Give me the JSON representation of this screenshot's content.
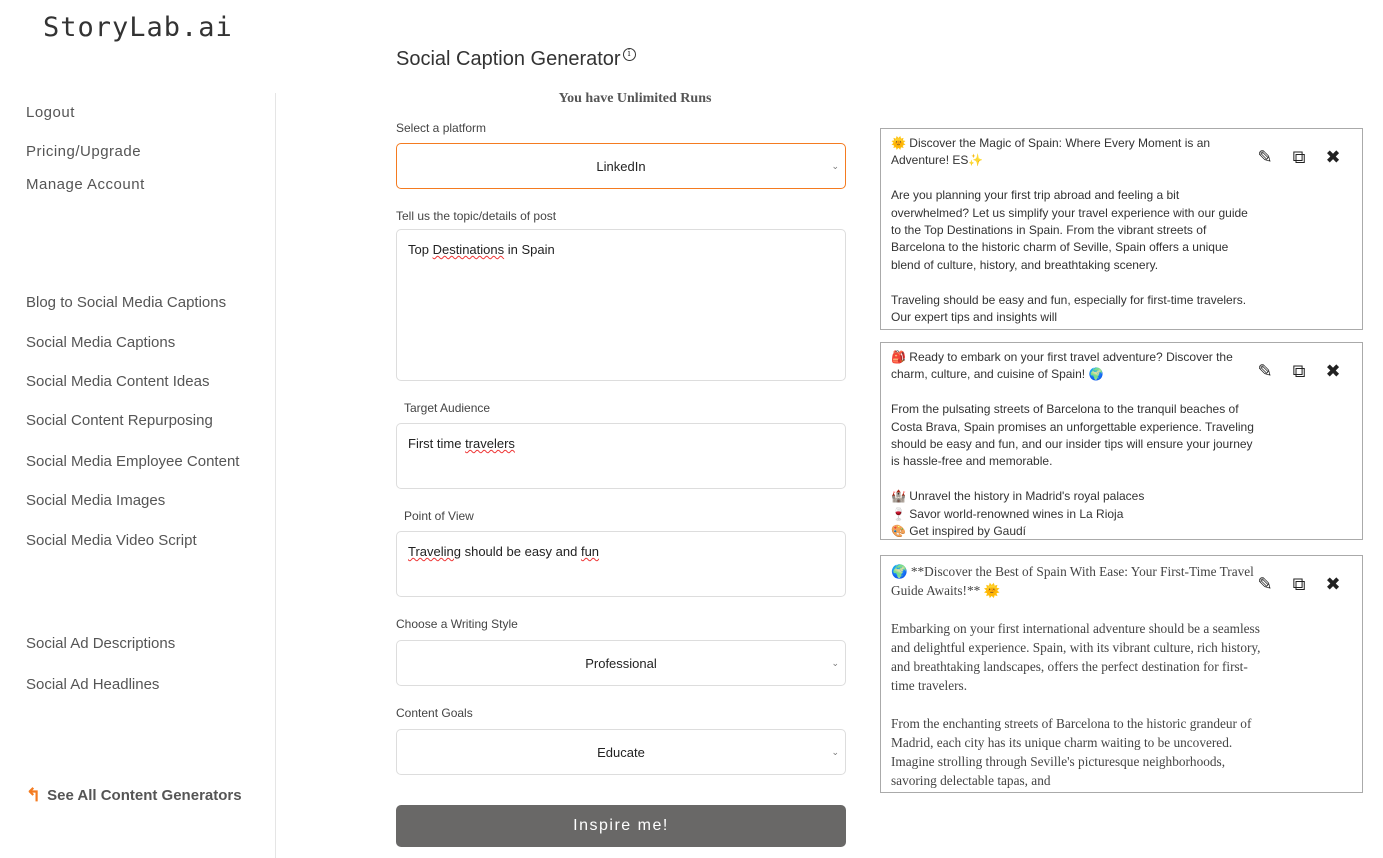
{
  "logo": "StoryLab.ai",
  "sidebar": {
    "account": [
      {
        "label": "Logout"
      },
      {
        "label": "Pricing/Upgrade"
      },
      {
        "label": "Manage Account"
      }
    ],
    "tools": [
      {
        "label": "Blog to Social Media Captions"
      },
      {
        "label": "Social Media Captions"
      },
      {
        "label": "Social Media Content Ideas"
      },
      {
        "label": "Social Content Repurposing"
      },
      {
        "label": "Social Media Employee Content"
      },
      {
        "label": "Social Media Images"
      },
      {
        "label": "Social Media Video Script"
      }
    ],
    "ads": [
      {
        "label": "Social Ad Descriptions"
      },
      {
        "label": "Social Ad Headlines"
      }
    ],
    "see_all": "See All Content Generators"
  },
  "main": {
    "title": "Social Caption Generator",
    "runs": "You have Unlimited Runs",
    "platform": {
      "label": "Select a platform",
      "value": "LinkedIn"
    },
    "topic": {
      "label": "Tell us the topic/details of post",
      "value_pre": "Top ",
      "value_spell": "Destinations",
      "value_post": " in Spain"
    },
    "audience": {
      "label": "Target Audience",
      "value_pre": "First time ",
      "value_spell": "travelers"
    },
    "pov": {
      "label": "Point of View",
      "value_spell": "Traveling",
      "value_mid": " should be easy and ",
      "value_spell2": "fun"
    },
    "style": {
      "label": "Choose a Writing Style",
      "value": "Professional"
    },
    "goals": {
      "label": "Content Goals",
      "value": "Educate"
    },
    "submit": "Inspire me!"
  },
  "accent": "#f47b20",
  "results": [
    {
      "text": "🌞 Discover the Magic of Spain: Where Every Moment is an Adventure! ES✨\n\nAre you planning your first trip abroad and feeling a bit overwhelmed? Let us simplify your travel experience with our guide to the Top Destinations in Spain. From the vibrant streets of Barcelona to the historic charm of Seville, Spain offers a unique blend of culture, history, and breathtaking scenery.\n\nTraveling should be easy and fun, especially for first-time travelers. Our expert tips and insights will"
    },
    {
      "text": "🎒 Ready to embark on your first travel adventure? Discover the charm, culture, and cuisine of Spain! 🌍\n\nFrom the pulsating streets of Barcelona to the tranquil beaches of Costa Brava, Spain promises an unforgettable experience. Traveling should be easy and fun, and our insider tips will ensure your journey is hassle-free and memorable.\n\n🏰 Unravel the history in Madrid's royal palaces\n🍷 Savor world-renowned wines in La Rioja\n🎨 Get inspired by Gaudí"
    },
    {
      "text": "🌍 **Discover the Best of Spain With Ease: Your First-Time Travel Guide Awaits!** 🌞\n\nEmbarking on your first international adventure should be a seamless and delightful experience. Spain, with its vibrant culture, rich history, and breathtaking landscapes, offers the perfect destination for first-time travelers.\n\nFrom the enchanting streets of Barcelona to the historic grandeur of Madrid, each city has its unique charm waiting to be uncovered. Imagine strolling through Seville's picturesque neighborhoods, savoring delectable tapas, and"
    }
  ],
  "icons": {
    "edit": "edit-icon",
    "copy": "copy-icon",
    "close": "close-icon",
    "info": "info-icon",
    "back": "back-arrow-icon",
    "chevron": "chevron-down-icon"
  }
}
